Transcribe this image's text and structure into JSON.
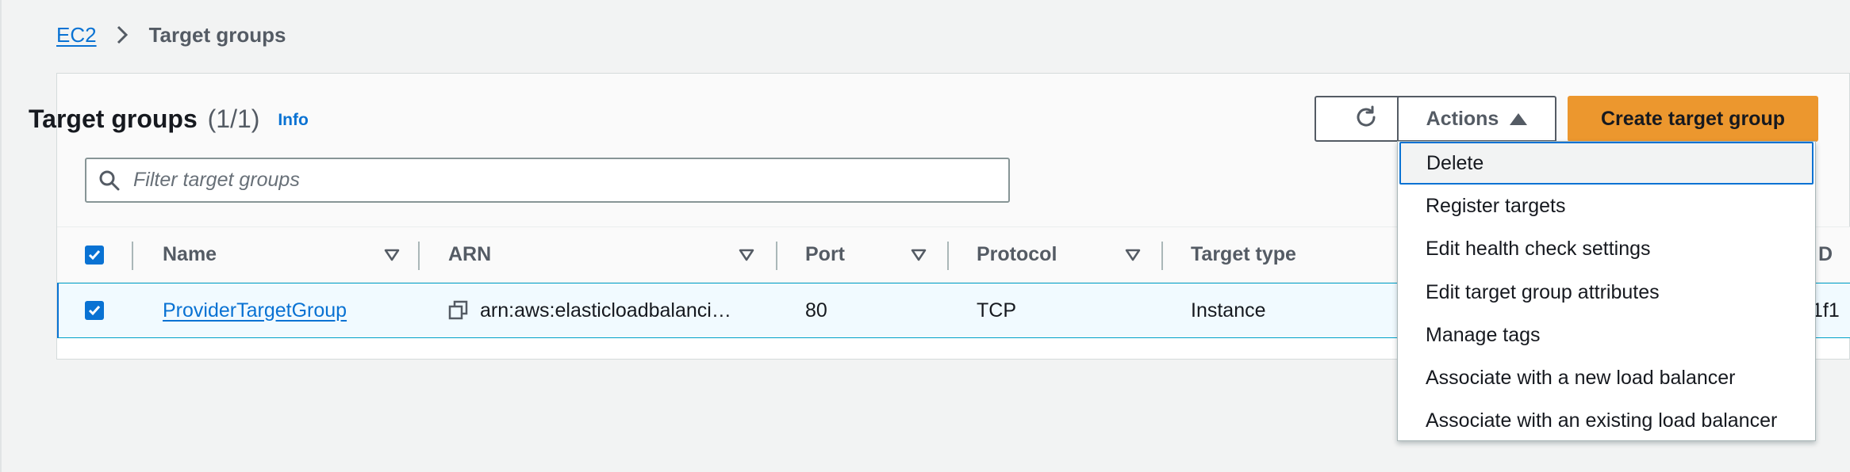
{
  "breadcrumb": {
    "root": "EC2",
    "current": "Target groups"
  },
  "panel": {
    "title": "Target groups",
    "count": "(1/1)",
    "info_link": "Info",
    "search_placeholder": "Filter target groups",
    "actions_label": "Actions",
    "create_label": "Create target group"
  },
  "table": {
    "columns": [
      "Name",
      "ARN",
      "Port",
      "Protocol",
      "Target type",
      "D"
    ],
    "rows": [
      {
        "name": "ProviderTargetGroup",
        "arn": "arn:aws:elasticloadbalanci…",
        "port": "80",
        "protocol": "TCP",
        "target_type": "Instance",
        "overflow": "1f1"
      }
    ]
  },
  "actions_menu": {
    "items": [
      "Delete",
      "Register targets",
      "Edit health check settings",
      "Edit target group attributes",
      "Manage tags",
      "Associate with a new load balancer",
      "Associate with an existing load balancer"
    ],
    "active_item": "Delete"
  },
  "colors": {
    "accent": "#0972d3",
    "primary_button": "#ec972e",
    "background": "#f2f3f3",
    "selected_row": "#f1faff"
  },
  "icons": {
    "breadcrumb_sep": "chevron-right-icon",
    "search": "search-icon",
    "refresh": "refresh-icon",
    "actions_caret": "caret-up-icon",
    "sort": "sort-triangle-icon",
    "copy": "copy-icon",
    "checkbox": "checkbox-checked-icon"
  }
}
